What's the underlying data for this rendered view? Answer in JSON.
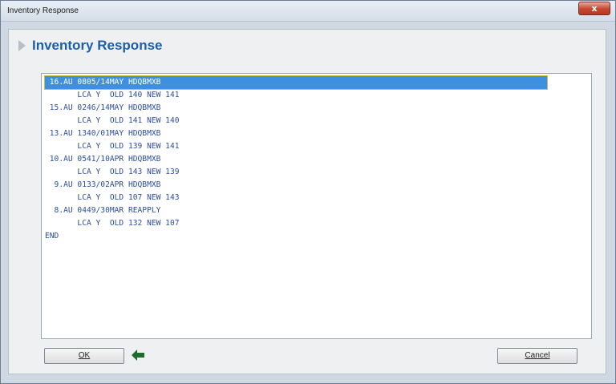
{
  "window": {
    "title": "Inventory Response",
    "close_glyph": "x"
  },
  "header": {
    "title": "Inventory Response"
  },
  "response": {
    "lines": [
      " 16.AU 0805/14MAY HDQBMXB",
      "       LCA Y  OLD 140 NEW 141",
      " 15.AU 0246/14MAY HDQBMXB",
      "       LCA Y  OLD 141 NEW 140",
      " 13.AU 1340/01MAY HDQBMXB",
      "       LCA Y  OLD 139 NEW 141",
      " 10.AU 0541/10APR HDQBMXB",
      "       LCA Y  OLD 143 NEW 139",
      "  9.AU 0133/02APR HDQBMXB",
      "       LCA Y  OLD 107 NEW 143",
      "  8.AU 0449/30MAR REAPPLY",
      "       LCA Y  OLD 132 NEW 107",
      "END"
    ],
    "selected_index": 0
  },
  "buttons": {
    "ok_label": "OK",
    "cancel_label": "Cancel"
  },
  "colors": {
    "title_blue": "#1d5ea8",
    "selection": "#3d8fe0",
    "arrow": "#1e6b2c"
  },
  "icons": {
    "header": "chevron-right-icon",
    "next": "arrow-left-icon"
  }
}
